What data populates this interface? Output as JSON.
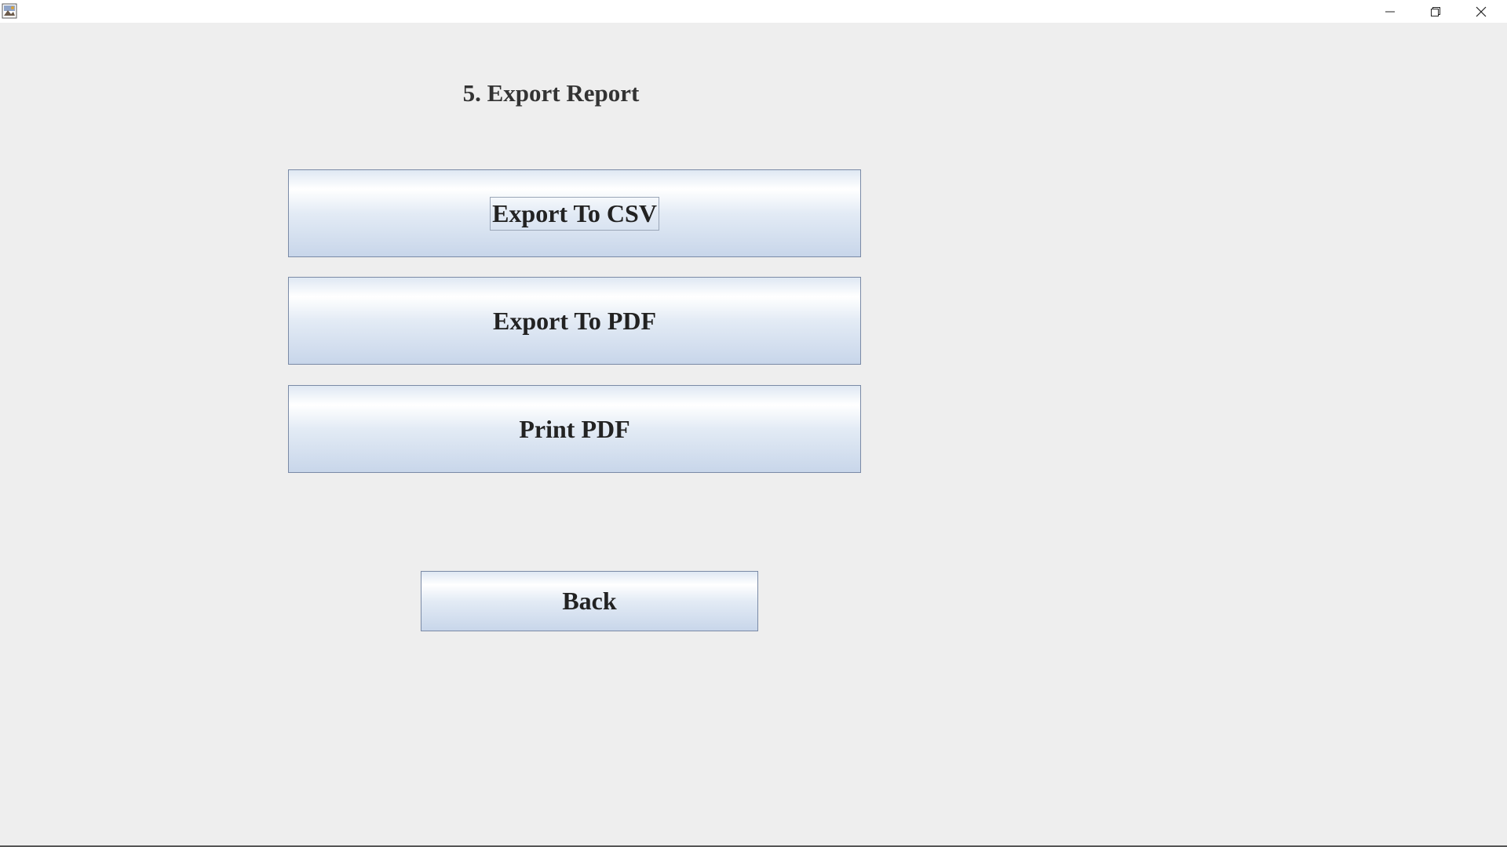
{
  "window": {
    "title": "",
    "app_icon": "java-app-icon",
    "controls": {
      "minimize_icon": "minimize-icon",
      "maximize_icon": "restore-icon",
      "close_icon": "close-icon"
    }
  },
  "main": {
    "heading": "5. Export Report",
    "buttons": {
      "export_csv": "Export To CSV",
      "export_pdf": "Export To PDF",
      "print_pdf": "Print PDF",
      "back": "Back"
    },
    "focused_button": "export_csv"
  },
  "colors": {
    "background": "#eeeeee",
    "button_border": "#7a8aa6",
    "button_gradient_top": "#ffffff",
    "button_gradient_bottom": "#c8d6ea"
  }
}
